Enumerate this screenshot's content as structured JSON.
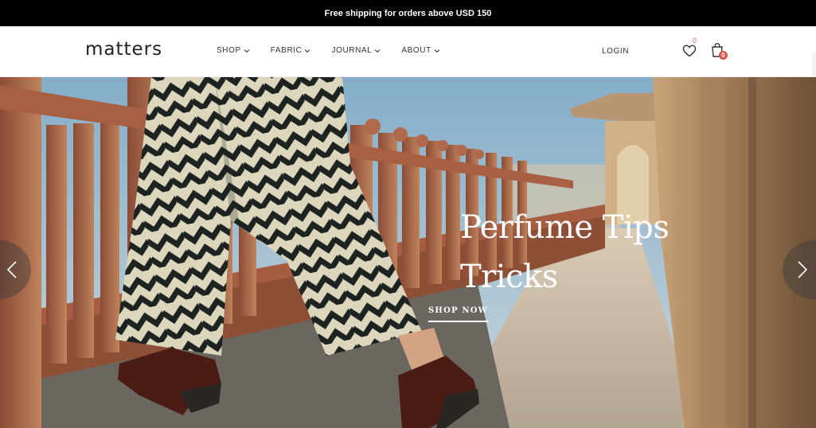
{
  "announcement": "Free shipping for orders above USD 150",
  "logo": "matters",
  "nav": [
    {
      "label": "SHOP"
    },
    {
      "label": "FABRIC"
    },
    {
      "label": "JOURNAL"
    },
    {
      "label": "ABOUT"
    }
  ],
  "account": {
    "login_label": "LOGIN"
  },
  "wishlist": {
    "count": "0",
    "icon": "heart-icon"
  },
  "cart": {
    "count": "0",
    "icon": "shopping-bag-icon"
  },
  "hero": {
    "title_line1": "Perfume Tips",
    "title_line2": "Tricks",
    "cta_label": "SHOP NOW",
    "prev_icon": "chevron-left-icon",
    "next_icon": "chevron-right-icon"
  },
  "colors": {
    "accent": "#d8574f",
    "topbar_bg": "#000000",
    "sky": "#9ab6c9",
    "sandstone": "#a9674a"
  }
}
